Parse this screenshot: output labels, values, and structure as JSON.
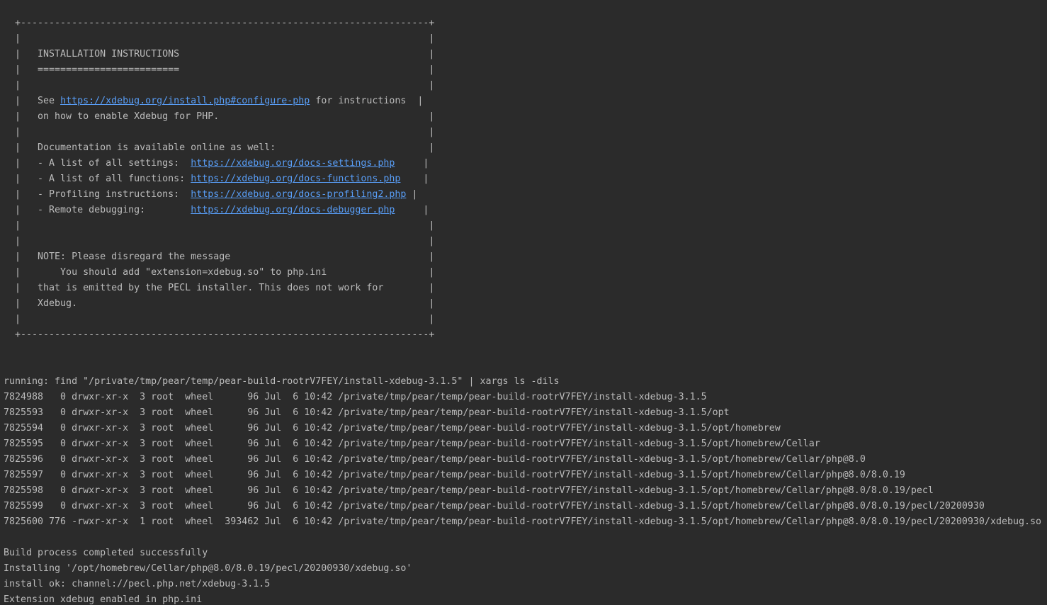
{
  "box": {
    "top_border": "  +------------------------------------------------------------------------+",
    "empty_row": "  |                                                                        |",
    "title": "  |   INSTALLATION INSTRUCTIONS                                            |",
    "underline": "  |   =========================                                            |",
    "see_pre": "  |   See ",
    "see_link": "https://xdebug.org/install.php#configure-php",
    "see_post": " for instructions  |",
    "enable": "  |   on how to enable Xdebug for PHP.                                     |",
    "docs": "  |   Documentation is available online as well:                           |",
    "settings_pre": "  |   - A list of all settings:  ",
    "settings_link": "https://xdebug.org/docs-settings.php",
    "settings_post": "     |",
    "functions_pre": "  |   - A list of all functions: ",
    "functions_link": "https://xdebug.org/docs-functions.php",
    "functions_post": "    |",
    "profiling_pre": "  |   - Profiling instructions:  ",
    "profiling_link": "https://xdebug.org/docs-profiling2.php",
    "profiling_post": " |",
    "remote_pre": "  |   - Remote debugging:        ",
    "remote_link": "https://xdebug.org/docs-debugger.php",
    "remote_post": "     |",
    "note1": "  |   NOTE: Please disregard the message                                   |",
    "note2": "  |       You should add \"extension=xdebug.so\" to php.ini                  |",
    "note3": "  |   that is emitted by the PECL installer. This does not work for        |",
    "note4": "  |   Xdebug.                                                              |",
    "bottom_border": "  +------------------------------------------------------------------------+"
  },
  "running": "running: find \"/private/tmp/pear/temp/pear-build-rootrV7FEY/install-xdebug-3.1.5\" | xargs ls -dils",
  "listing": [
    "7824988   0 drwxr-xr-x  3 root  wheel      96 Jul  6 10:42 /private/tmp/pear/temp/pear-build-rootrV7FEY/install-xdebug-3.1.5",
    "7825593   0 drwxr-xr-x  3 root  wheel      96 Jul  6 10:42 /private/tmp/pear/temp/pear-build-rootrV7FEY/install-xdebug-3.1.5/opt",
    "7825594   0 drwxr-xr-x  3 root  wheel      96 Jul  6 10:42 /private/tmp/pear/temp/pear-build-rootrV7FEY/install-xdebug-3.1.5/opt/homebrew",
    "7825595   0 drwxr-xr-x  3 root  wheel      96 Jul  6 10:42 /private/tmp/pear/temp/pear-build-rootrV7FEY/install-xdebug-3.1.5/opt/homebrew/Cellar",
    "7825596   0 drwxr-xr-x  3 root  wheel      96 Jul  6 10:42 /private/tmp/pear/temp/pear-build-rootrV7FEY/install-xdebug-3.1.5/opt/homebrew/Cellar/php@8.0",
    "7825597   0 drwxr-xr-x  3 root  wheel      96 Jul  6 10:42 /private/tmp/pear/temp/pear-build-rootrV7FEY/install-xdebug-3.1.5/opt/homebrew/Cellar/php@8.0/8.0.19",
    "7825598   0 drwxr-xr-x  3 root  wheel      96 Jul  6 10:42 /private/tmp/pear/temp/pear-build-rootrV7FEY/install-xdebug-3.1.5/opt/homebrew/Cellar/php@8.0/8.0.19/pecl",
    "7825599   0 drwxr-xr-x  3 root  wheel      96 Jul  6 10:42 /private/tmp/pear/temp/pear-build-rootrV7FEY/install-xdebug-3.1.5/opt/homebrew/Cellar/php@8.0/8.0.19/pecl/20200930",
    "7825600 776 -rwxr-xr-x  1 root  wheel  393462 Jul  6 10:42 /private/tmp/pear/temp/pear-build-rootrV7FEY/install-xdebug-3.1.5/opt/homebrew/Cellar/php@8.0/8.0.19/pecl/20200930/xdebug.so"
  ],
  "build_complete": "Build process completed successfully",
  "installing": "Installing '/opt/homebrew/Cellar/php@8.0/8.0.19/pecl/20200930/xdebug.so'",
  "install_ok": "install ok: channel://pecl.php.net/xdebug-3.1.5",
  "extension_enabled": "Extension xdebug enabled in php.ini",
  "colors": {
    "background": "#2b2b2b",
    "text": "#bbbbbb",
    "link": "#589df6"
  }
}
